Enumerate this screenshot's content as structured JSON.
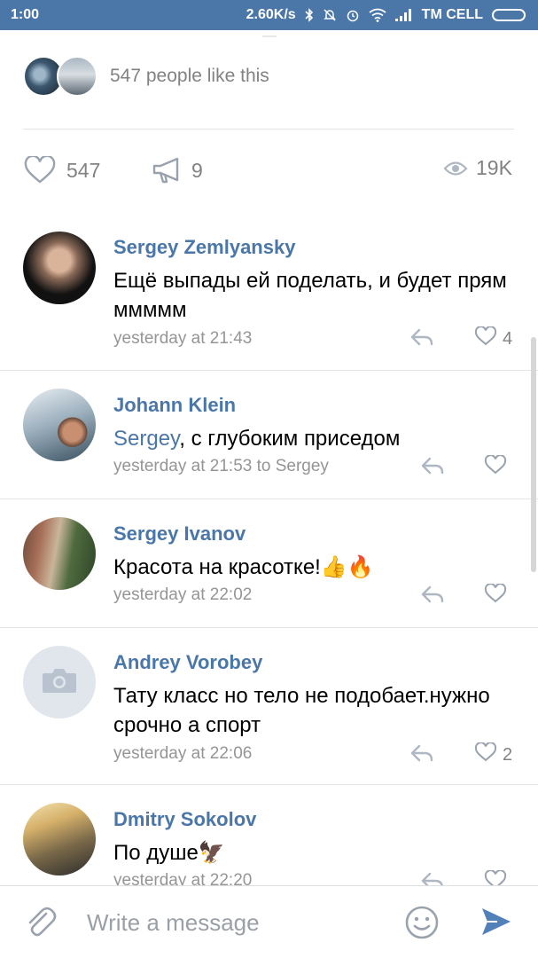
{
  "status_bar": {
    "time": "1:00",
    "speed": "2.60K/s",
    "carrier": "TM CELL"
  },
  "likers": {
    "text": "547 people like this"
  },
  "stats": {
    "likes": "547",
    "reposts": "9",
    "views": "19K"
  },
  "comments": [
    {
      "name": "Sergey Zemlyansky",
      "text": "Ещё выпады ей поделать, и будет прям ммммм",
      "meta": "yesterday at 21:43",
      "likes": "4"
    },
    {
      "name": "Johann Klein",
      "mention": "Sergey",
      "text": ", с глубоким приседом",
      "meta": "yesterday at 21:53 to Sergey",
      "likes": ""
    },
    {
      "name": "Sergey Ivanov",
      "text": "Красота на красотке!👍🔥",
      "meta": "yesterday at 22:02",
      "likes": ""
    },
    {
      "name": "Andrey Vorobey",
      "text": "Тату класс   но тело не подобает.нужно срочно а спорт",
      "meta": "yesterday at 22:06",
      "likes": "2"
    },
    {
      "name": "Dmitry Sokolov",
      "text": "По душе🦅",
      "meta": "yesterday at 22:20",
      "likes": ""
    }
  ],
  "composer": {
    "placeholder": "Write a message"
  },
  "icons": {
    "heart": "heart-icon",
    "repost": "megaphone-icon",
    "views": "eye-icon",
    "reply": "reply-icon",
    "attach": "paperclip-icon",
    "emoji": "smiley-icon",
    "send": "send-icon",
    "camera": "camera-icon"
  },
  "colors": {
    "accent": "#4a76a8",
    "meta_gray": "#959595",
    "divider": "#e2e4e8"
  }
}
